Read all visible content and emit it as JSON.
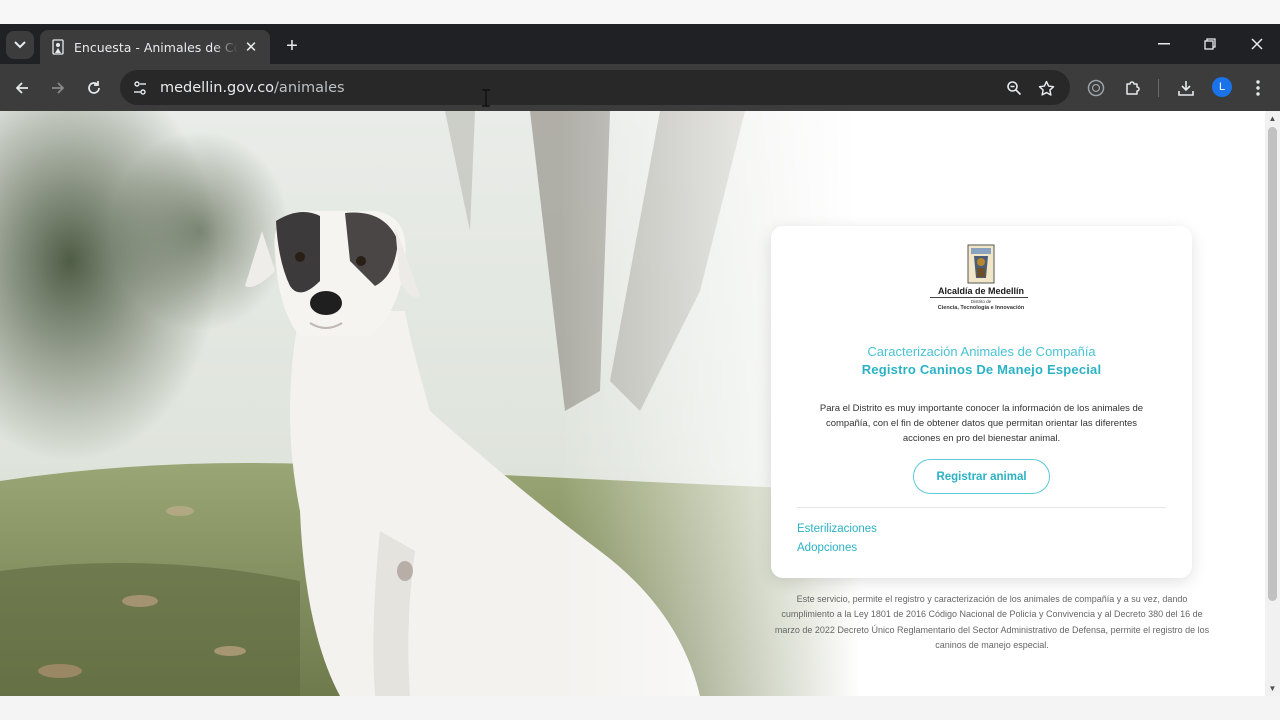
{
  "browser": {
    "tab_title": "Encuesta - Animales de Compañía",
    "url_host": "medellin.gov.co",
    "url_path": "/animales",
    "profile_initial": "L",
    "accent": "#1a73e8"
  },
  "card": {
    "logo": {
      "org_name": "Alcaldía de Medellín",
      "sub_line_1": "Distrito de",
      "sub_line_2": "Ciencia, Tecnología e Innovación"
    },
    "title": "Caracterización Animales de Compañía",
    "heading": "Registro Caninos De Manejo Especial",
    "description": "Para el Distrito es muy importante conocer la información de los animales de compañía, con el fin de obtener datos que permitan orientar las diferentes acciones en pro del bienestar animal.",
    "register_button": "Registrar animal",
    "links": [
      "Esterilizaciones",
      "Adopciones"
    ],
    "accent_color": "#2bb2c4"
  },
  "footnote": "Este servicio, permite el registro y caracterización de los animales de compañía y a su vez, dando cumplimiento a la Ley 1801 de 2016 Código Nacional de Policía y Convivencia y al Decreto 380 del 16 de marzo de 2022 Decreto Único Reglamentario del Sector Administrativo de Defensa, permite el registro de los caninos de manejo especial."
}
